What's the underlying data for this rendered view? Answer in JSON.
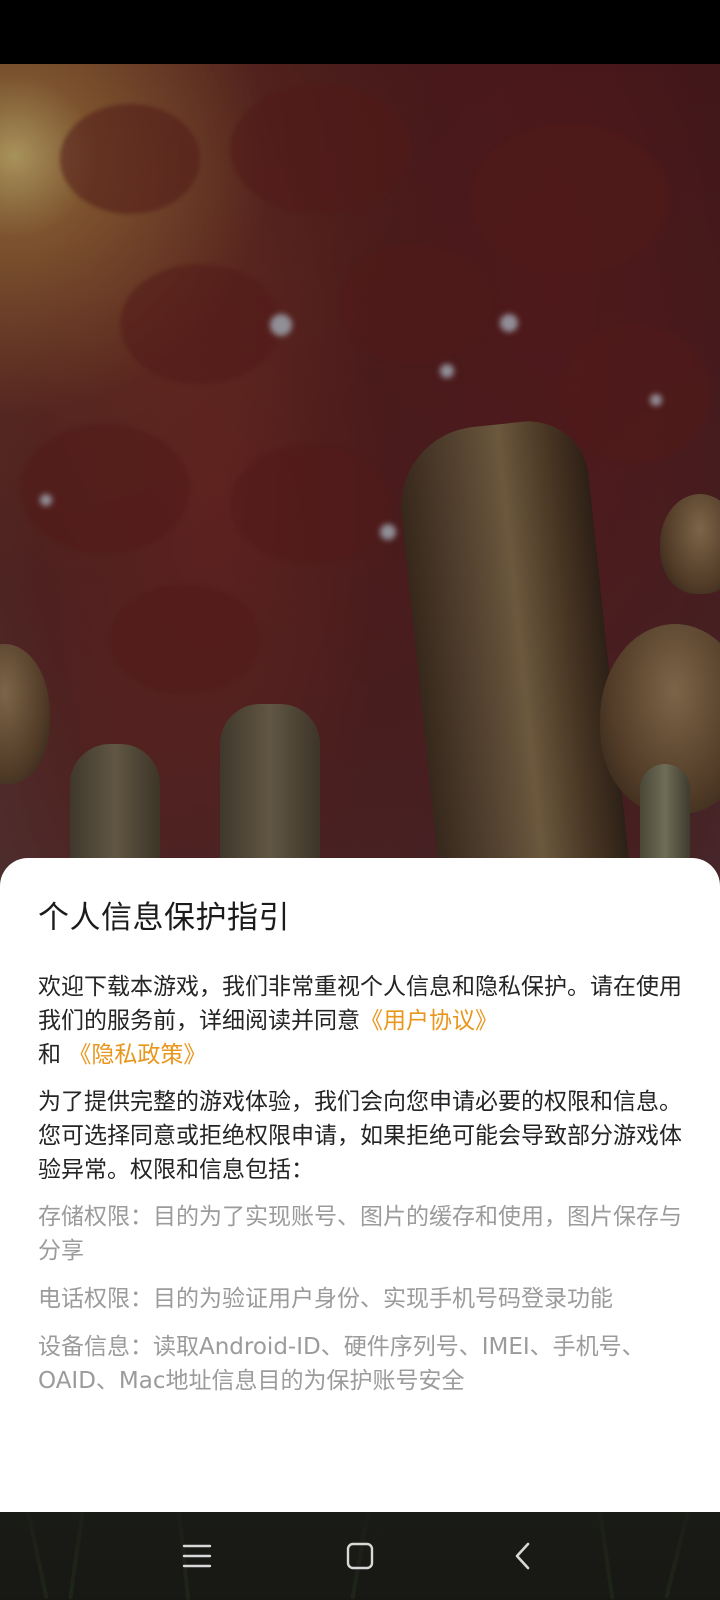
{
  "dialog": {
    "title": "个人信息保护指引",
    "intro_part1": "欢迎下载本游戏，我们非常重视个人信息和隐私保护。请在使用我们的服务前，详细阅读并同意",
    "user_agreement_link": "《用户协议》",
    "intro_and": "和",
    "privacy_policy_link": "《隐私政策》",
    "permissions_intro": "为了提供完整的游戏体验，我们会向您申请必要的权限和信息。您可选择同意或拒绝权限申请，如果拒绝可能会导致部分游戏体验异常。权限和信息包括：",
    "permissions": [
      "存储权限：目的为了实现账号、图片的缓存和使用，图片保存与分享",
      "电话权限：目的为验证用户身份、实现手机号码登录功能",
      "设备信息：读取Android-ID、硬件序列号、IMEI、手机号、OAID、Mac地址信息目的为保护账号安全"
    ]
  },
  "nav": {
    "recents": "menu-icon",
    "home": "home-icon",
    "back": "back-icon"
  },
  "colors": {
    "link": "#e8961c",
    "title": "#1b1b1b",
    "body": "#242424",
    "muted": "#9b9b9b",
    "sheet": "#ffffff"
  }
}
